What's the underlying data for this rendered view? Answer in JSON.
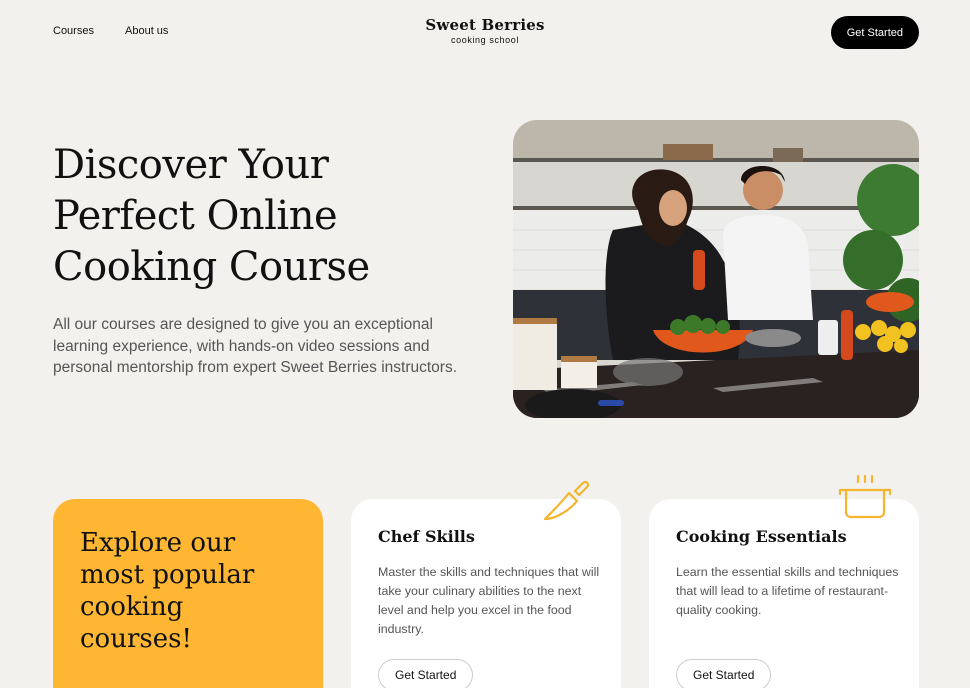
{
  "nav": {
    "links": [
      "Courses",
      "About us"
    ],
    "logo_main": "Sweet Berries",
    "logo_sub": "cooking school",
    "cta": "Get Started"
  },
  "hero": {
    "title": "Discover Your Perfect Online Cooking Course",
    "text": "All our courses are designed to give you an exceptional learning experience, with hands-on video sessions and personal mentorship from expert Sweet Berries instructors."
  },
  "explore": {
    "heading": "Explore our most popular cooking courses!"
  },
  "courses": [
    {
      "title": "Chef Skills",
      "text": "Master the skills and techniques that will take your culinary abilities to the next level and help you excel in the food industry.",
      "button": "Get Started",
      "icon": "knife-icon"
    },
    {
      "title": "Cooking Essentials",
      "text": "Learn the essential skills and techniques that will lead to a lifetime of restaurant-quality cooking.",
      "button": "Get Started",
      "icon": "pot-icon"
    }
  ],
  "colors": {
    "background": "#f2f1ee",
    "accent": "#ffb733",
    "dark": "#000000"
  }
}
